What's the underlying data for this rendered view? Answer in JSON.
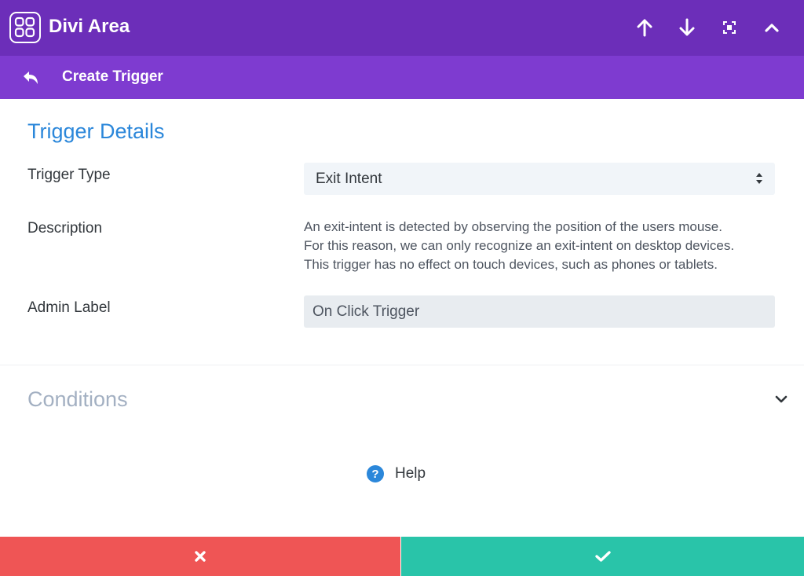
{
  "header": {
    "app_title": "Divi Area",
    "logo_icon": "divi-area-logo-icon",
    "actions": [
      "arrow-up-icon",
      "arrow-down-icon",
      "expand-icon",
      "collapse-icon"
    ],
    "background": "#6c2eb9"
  },
  "subheader": {
    "title": "Create Trigger",
    "back_icon": "undo-icon",
    "background": "#7e3bd0"
  },
  "trigger_details": {
    "section_title": "Trigger Details",
    "trigger_type_label": "Trigger Type",
    "trigger_type_value": "Exit Intent",
    "description_label": "Description",
    "description_lines": [
      "An exit-intent is detected by observing the position of the users mouse.",
      "For this reason, we can only recognize an exit-intent on desktop devices.",
      "This trigger has no effect on touch devices, such as phones or tablets."
    ],
    "admin_label_label": "Admin Label",
    "admin_label_value": "On Click Trigger"
  },
  "conditions": {
    "section_title": "Conditions",
    "chevron_icon": "chevron-down-icon"
  },
  "help": {
    "label": "Help",
    "icon": "question-circle-icon",
    "icon_glyph": "?"
  },
  "footer": {
    "cancel_icon": "close-icon",
    "cancel_color": "#ef5555",
    "save_icon": "checkmark-icon",
    "save_color": "#29c4a9"
  },
  "colors": {
    "accent_blue": "#2b87da",
    "muted_title": "#a3b0c2"
  }
}
